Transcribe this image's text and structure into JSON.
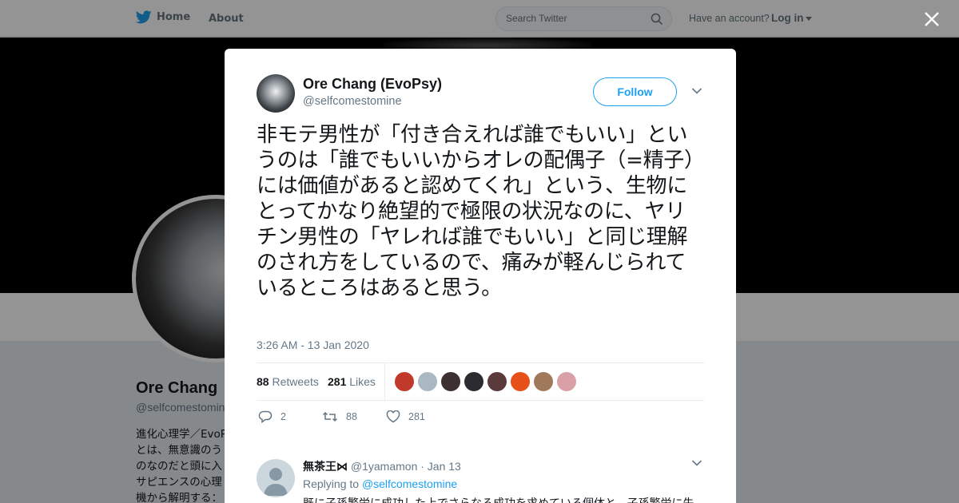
{
  "nav": {
    "home_label": "Home",
    "about_label": "About",
    "search_placeholder": "Search Twitter",
    "have_account": "Have an account?",
    "login_label": "Log in"
  },
  "background_profile": {
    "name": "Ore Chang",
    "handle": "@selfcomestomine",
    "bio_lines": [
      "進化心理学／EvoPsy",
      "とは、無意識のう",
      "のなのだと頭に入",
      "サピエンスの心理",
      "機から解明する："
    ]
  },
  "tweet": {
    "author_name": "Ore Chang (EvoPsy)",
    "author_handle": "@selfcomestomine",
    "follow_label": "Follow",
    "text": "非モテ男性が「付き合えれば誰でもいい」というのは「誰でもいいからオレの配偶子（=精子）には価値があると認めてくれ」という、生物にとってかなり絶望的で極限の状況なのに、ヤリチン男性の「ヤレれば誰でもいい」と同じ理解のされ方をしているので、痛みが軽んじられているところはあると思う。",
    "timestamp": "3:26 AM - 13 Jan 2020",
    "retweets_count": "88",
    "retweets_label": "Retweets",
    "likes_count": "281",
    "likes_label": "Likes",
    "action_reply_count": "2",
    "action_retweet_count": "88",
    "action_like_count": "281"
  },
  "likers": [
    {
      "color": "#c0392b"
    },
    {
      "color": "#aab8c2"
    },
    {
      "color": "#3d3030"
    },
    {
      "color": "#2c2c30"
    },
    {
      "color": "#5a3a3a"
    },
    {
      "color": "#e8501a"
    },
    {
      "color": "#a0785a"
    },
    {
      "color": "#d9a0a8"
    }
  ],
  "reply": {
    "name": "無茶王⋈",
    "handle": "@1yamamon",
    "date": "· Jan 13",
    "replying_to_label": "Replying to",
    "replying_to_handle": "@selfcomestomine",
    "text": "既に子孫繁栄に成功した上でさらなる成功を求めている個体と、子孫繁栄に失"
  },
  "colors": {
    "accent": "#1da1f2",
    "text": "#14171a",
    "muted": "#657786"
  }
}
